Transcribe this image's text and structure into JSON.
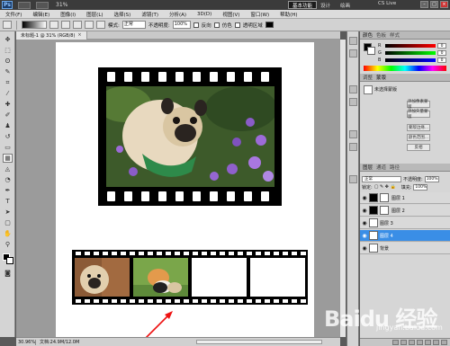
{
  "appbar": {
    "logo": "Ps",
    "zoom": "31%",
    "workspace_active": "基本功能",
    "workspace_2": "设计",
    "workspace_3": "绘画",
    "cs_live": "CS Live"
  },
  "menu": [
    "文件(F)",
    "编辑(E)",
    "图像(I)",
    "图层(L)",
    "选择(S)",
    "滤镜(T)",
    "分析(A)",
    "3D(D)",
    "视图(V)",
    "窗口(W)",
    "帮助(H)"
  ],
  "options": {
    "mode_label": "模式:",
    "mode_value": "正常",
    "opacity_label": "不透明度:",
    "opacity_value": "100%",
    "reverse_label": "反向",
    "dither_label": "仿色",
    "transparency_label": "透明区域"
  },
  "document": {
    "tab_title": "未标题-1 @ 31% (RGB/8)",
    "zoom": "30.96%",
    "doc_info": "文档:24.9M/12.0M"
  },
  "panels": {
    "color_tab": "颜色",
    "swatches_tab": "色板",
    "styles_tab": "样式",
    "adjust_tab": "调整",
    "masks_tab": "蒙版",
    "adjust_title": "未选择蒙版",
    "adjust_buttons": [
      "添加像素蒙版",
      "添加矢量蒙版",
      "蒙版边缘...",
      "颜色范围...",
      "反相"
    ],
    "layers_tab": "图层",
    "channels_tab": "通道",
    "paths_tab": "路径",
    "blend_mode": "正常",
    "opacity_label": "不透明度:",
    "opacity_value": "100%",
    "lock_label": "锁定:",
    "fill_label": "填充:",
    "fill_value": "100%",
    "layers": [
      {
        "name": "图层 1"
      },
      {
        "name": "图层 2"
      },
      {
        "name": "图层 3"
      },
      {
        "name": "图层 4"
      },
      {
        "name": "背景"
      }
    ]
  },
  "watermark": {
    "brand": "Baidu 经验",
    "sub": "jingyan.baidu.com"
  }
}
